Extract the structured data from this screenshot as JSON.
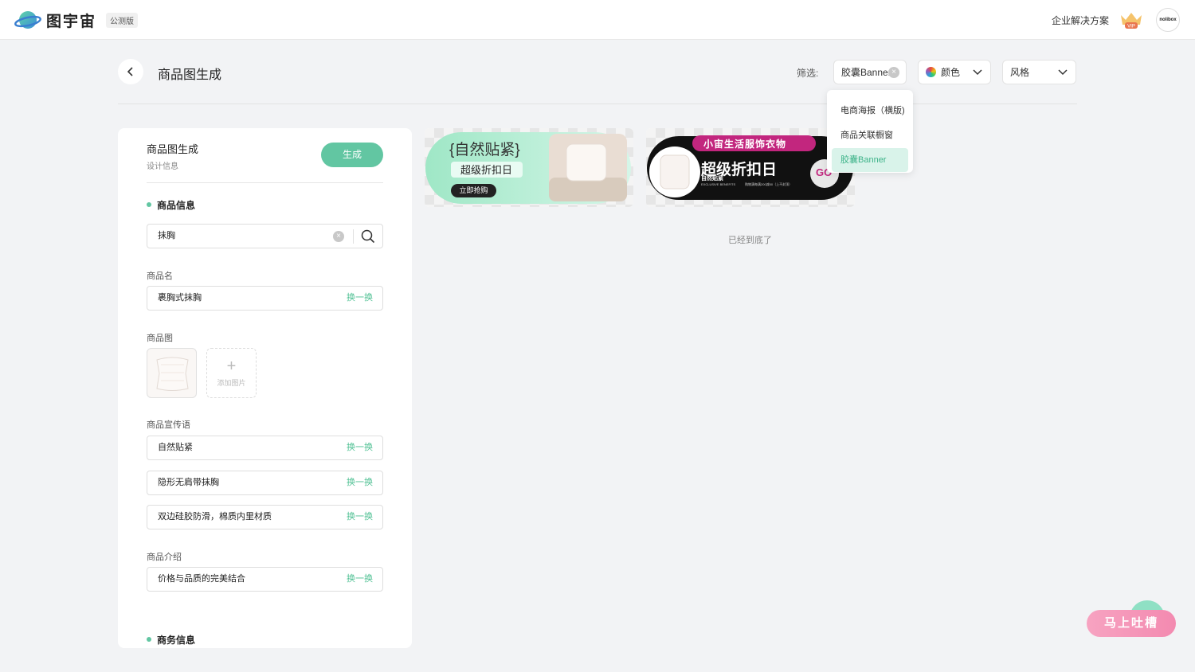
{
  "app": {
    "name": "图宇宙",
    "badge": "公测版"
  },
  "topbar": {
    "enterprise_label": "企业解决方案",
    "vip_label": "VIP",
    "avatar_text": "nolibox"
  },
  "header": {
    "title": "商品图生成",
    "filter_label": "筛选:"
  },
  "filters": {
    "type_value": "胶囊Banner",
    "color_label": "颜色",
    "style_label": "风格",
    "dropdown_options": [
      "电商海报（横版)",
      "商品关联橱窗",
      "胶囊Banner"
    ],
    "selected_index": 2
  },
  "panel": {
    "title": "商品图生成",
    "subtitle": "设计信息",
    "generate_label": "生成",
    "product_info_section": "商品信息",
    "search_value": "抹胸",
    "name_label": "商品名",
    "name_value": "裹胸式抹胸",
    "swap_label": "换一换",
    "image_label": "商品图",
    "add_image_label": "添加图片",
    "slogan_label": "商品宣传语",
    "slogans": [
      "自然贴紧",
      "隐形无肩带抹胸",
      "双边硅胶防滑，棉质内里材质"
    ],
    "intro_label": "商品介绍",
    "intro_value": "价格与品质的完美结合",
    "business_section": "商务信息"
  },
  "results": {
    "card1": {
      "headline": "{自然贴紧}",
      "subline": "超级折扣日",
      "cta": "立即抢购"
    },
    "card2": {
      "top_banner": "小宙生活服饰衣物",
      "headline": "超级折扣日",
      "subline": "自然贴紧",
      "small_left": "EXCLUSIVE BENEFITS",
      "small_right": "购物满每满200减50（上不封顶）",
      "go": "GO"
    },
    "end_text": "已经到底了"
  },
  "feedback": {
    "label": "马上吐槽"
  },
  "colors": {
    "accent": "#62c6a2",
    "swap_text": "#4fc093",
    "feedback_pink": "#f38ab0"
  }
}
